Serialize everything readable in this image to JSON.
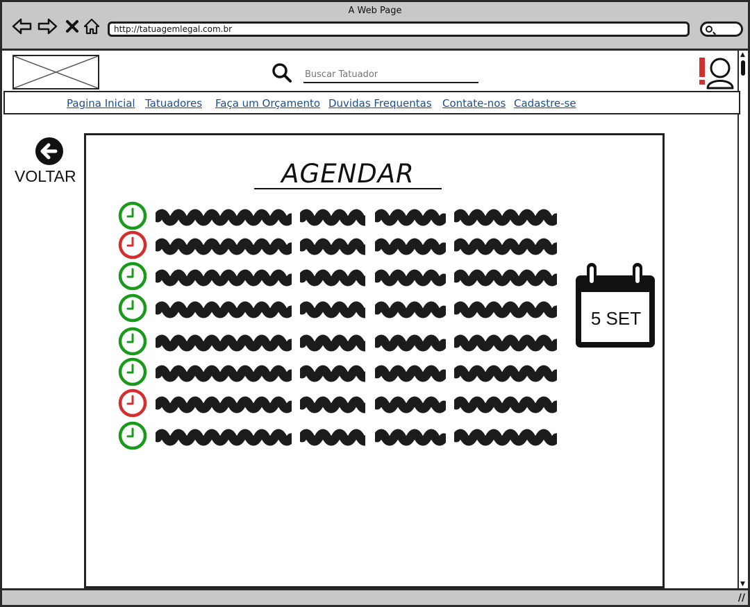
{
  "browser": {
    "title": "A Web Page",
    "url": "http://tatuagemlegal.com.br",
    "nav_icons": [
      "back-arrow-icon",
      "forward-arrow-icon",
      "close-x-icon",
      "home-icon"
    ]
  },
  "header": {
    "logo": "image-placeholder",
    "search_placeholder": "Buscar Tatuador",
    "user_icon": "user-alert-icon",
    "alert_color": "#d32f2f"
  },
  "nav": {
    "links": [
      "Pagina Inicial",
      "Tatuadores",
      "Faça um Orçamento",
      "Duvidas Frequentas",
      "Contate-nos",
      "Cadastre-se"
    ],
    "link_color": "#1e4d8c"
  },
  "back": {
    "label": "VOLTAR"
  },
  "main": {
    "title": "AGENDAR",
    "slots": [
      {
        "status": "available"
      },
      {
        "status": "unavailable"
      },
      {
        "status": "available"
      },
      {
        "status": "available"
      },
      {
        "status": "available"
      },
      {
        "status": "available"
      },
      {
        "status": "unavailable"
      },
      {
        "status": "available"
      }
    ],
    "status_colors": {
      "available": "#1a9a1a",
      "unavailable": "#d32f2f"
    },
    "calendar_label": "5 SET"
  }
}
